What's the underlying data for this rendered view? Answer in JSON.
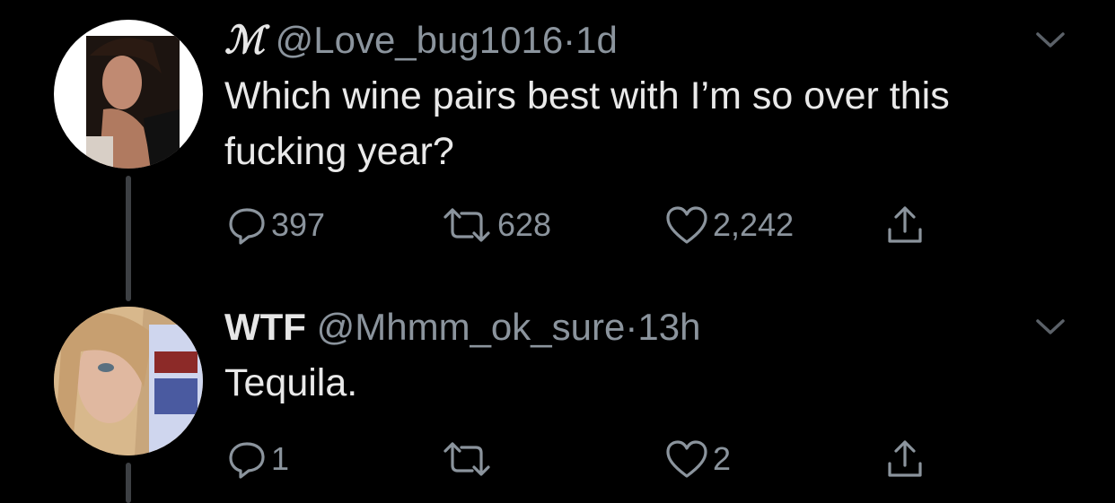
{
  "tweets": [
    {
      "display_name": "ℳ",
      "handle": "@Love_bug1016",
      "separator": "·",
      "time": "1d",
      "text": "Which wine pairs best with I’m so over this fucking year?",
      "replies": "397",
      "retweets": "628",
      "likes": "2,242"
    },
    {
      "display_name": "WTF",
      "handle": "@Mhmm_ok_sure",
      "separator": "·",
      "time": "13h",
      "text": "Tequila.",
      "replies": "1",
      "retweets": "",
      "likes": "2"
    }
  ],
  "icons": {
    "reply": "reply-icon",
    "retweet": "retweet-icon",
    "like": "heart-icon",
    "share": "share-icon",
    "more": "chevron-down-icon"
  },
  "colors": {
    "background": "#000000",
    "text_primary": "#e9e9e9",
    "text_secondary": "#8b949d",
    "thread_line": "#3d4044"
  }
}
